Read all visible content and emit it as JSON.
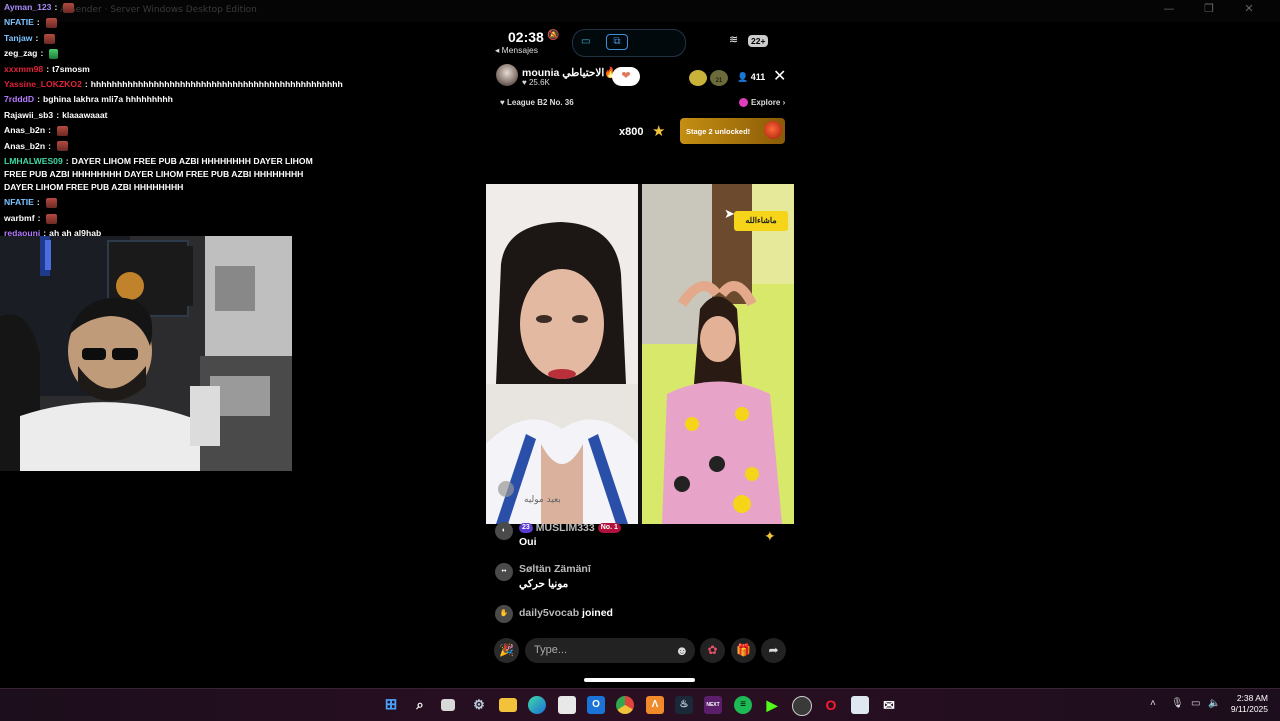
{
  "window": {
    "faded_title": "ArSender · Server Windows Desktop Edition",
    "controls": [
      "—",
      "❐",
      "✕"
    ]
  },
  "chat": [
    {
      "user": "Ayman_123",
      "color": "#a78bfa",
      "msg": "",
      "emote": "red"
    },
    {
      "user": "NFATIE",
      "color": "#7dc4ff",
      "msg": "",
      "emote": "red"
    },
    {
      "user": "Tanjaw",
      "color": "#7dc4ff",
      "msg": "",
      "emote": "red"
    },
    {
      "user": "zeg_zag",
      "color": "#ffffff",
      "msg": "",
      "emote": "green"
    },
    {
      "user": "xxxmm98",
      "color": "#e0243a",
      "msg": "t7smosm",
      "emote": ""
    },
    {
      "user": "Yassine_LOKZKO2",
      "color": "#e0243a",
      "msg": "hhhhhhhhhhhhhhhhhhhhhhhhhhhhhhhhhhhhhhhhhhhhhhhh",
      "emote": ""
    },
    {
      "user": "7rdddD",
      "color": "#b57bff",
      "msg": "bghina lakhra mli7a hhhhhhhhh",
      "emote": ""
    },
    {
      "user": "Rajawii_sb3",
      "color": "#ffffff",
      "msg": "klaaawaaat",
      "emote": ""
    },
    {
      "user": "Anas_b2n",
      "color": "#ffffff",
      "msg": "",
      "emote": "red"
    },
    {
      "user": "Anas_b2n",
      "color": "#ffffff",
      "msg": "",
      "emote": "red"
    },
    {
      "user": "LMHALWES09",
      "color": "#3fd9a8",
      "msg": "DAYER LIHOM FREE PUB AZBI HHHHHHHH DAYER LIHOM FREE PUB AZBI HHHHHHHH DAYER LIHOM FREE PUB AZBI HHHHHHHH DAYER LIHOM FREE PUB AZBI HHHHHHHH",
      "emote": "",
      "wrap": true
    },
    {
      "user": "NFATIE",
      "color": "#7dc4ff",
      "msg": "",
      "emote": "red"
    },
    {
      "user": "warbmf",
      "color": "#ffffff",
      "msg": "",
      "emote": "red"
    },
    {
      "user": "redaouni",
      "color": "#b57bff",
      "msg": "ah ah al9hab",
      "emote": ""
    }
  ],
  "phone": {
    "time": "02:38",
    "back_label": "◂ Mensajes",
    "battery": "22+",
    "host": {
      "name": "mounia الاحتياطي🔥",
      "likes": "♥ 25.6K"
    },
    "mini_avatar_label": "21",
    "viewers": "411",
    "league": "League B2 No. 36",
    "explore": "Explore",
    "multiplier": "x800",
    "stage_text": "Stage 2 unlocked!",
    "sticker_text": "ماشاءالله",
    "video_caption": "بعيد موليه",
    "comments": [
      {
        "level": "23",
        "name": "MUSLIM333",
        "badge": "No. 1",
        "text": "Oui"
      },
      {
        "name": "Søltän Zämänī",
        "text": "مونيا حركي"
      },
      {
        "name": "daily5vocab",
        "text": "joined"
      }
    ],
    "input_placeholder": "Type..."
  },
  "taskbar": {
    "time": "2:38 AM",
    "date": "9/11/2025",
    "apps": [
      "start",
      "search",
      "task-view",
      "settings",
      "file-explorer",
      "edge",
      "store",
      "outlook",
      "chrome",
      "apowersoft",
      "steam",
      "kick-next",
      "spotify",
      "kick",
      "obs",
      "opera",
      "notepad",
      "mail"
    ]
  }
}
